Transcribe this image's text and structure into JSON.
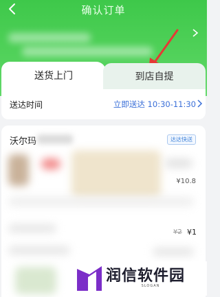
{
  "header": {
    "title": "确认订单",
    "accent": "#3ec84a"
  },
  "delivery_tabs": {
    "tabs": [
      {
        "label": "送货上门",
        "selected": true
      },
      {
        "label": "到店自提",
        "selected": false
      }
    ]
  },
  "delivery_time": {
    "label": "送达时间",
    "value": "立即送达 10:30-11:30",
    "value_color": "#3a6fd8"
  },
  "store": {
    "name": "沃尔玛",
    "badge": "达达快送",
    "item_price": "¥10.8",
    "original_price": "¥2",
    "price": "¥1"
  },
  "watermark": {
    "text": "润信软件园",
    "slogan": "SLOGAN"
  }
}
